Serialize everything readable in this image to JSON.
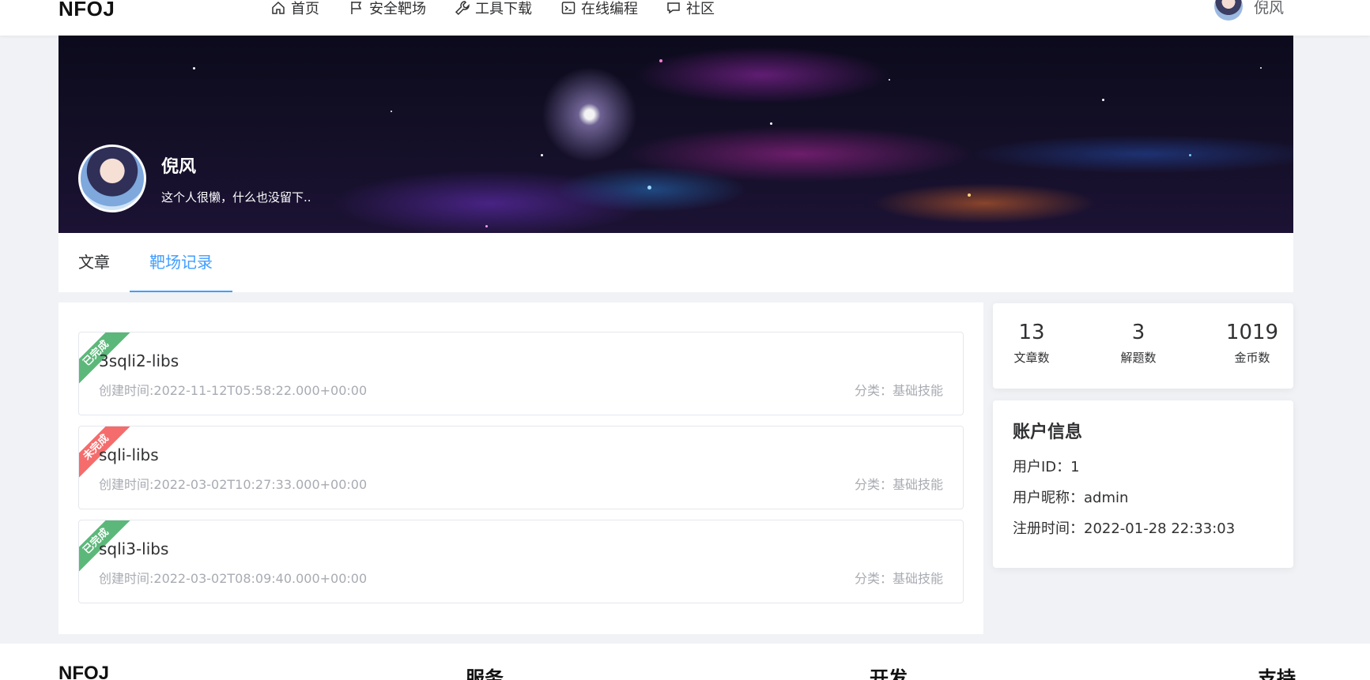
{
  "nav": {
    "brand": "NFOJ",
    "items": [
      {
        "label": "首页",
        "icon": "home-icon"
      },
      {
        "label": "安全靶场",
        "icon": "flag-icon"
      },
      {
        "label": "工具下载",
        "icon": "wrench-icon"
      },
      {
        "label": "在线编程",
        "icon": "terminal-icon"
      },
      {
        "label": "社区",
        "icon": "chat-icon"
      }
    ],
    "username": "倪风"
  },
  "profile": {
    "name": "倪风",
    "bio": "这个人很懒，什么也没留下.."
  },
  "tabs": [
    {
      "label": "文章",
      "active": false
    },
    {
      "label": "靶场记录",
      "active": true
    }
  ],
  "records": [
    {
      "status": "已完成",
      "status_color": "#5cb87a",
      "title": "3sqli2-libs",
      "created": "创建时间:2022-11-12T05:58:22.000+00:00",
      "category": "分类：基础技能"
    },
    {
      "status": "未完成",
      "status_color": "#f56c6c",
      "title": "sqli-libs",
      "created": "创建时间:2022-03-02T10:27:33.000+00:00",
      "category": "分类：基础技能"
    },
    {
      "status": "已完成",
      "status_color": "#5cb87a",
      "title": "sqli3-libs",
      "created": "创建时间:2022-03-02T08:09:40.000+00:00",
      "category": "分类：基础技能"
    }
  ],
  "stats": {
    "articles": {
      "value": "13",
      "label": "文章数"
    },
    "solved": {
      "value": "3",
      "label": "解题数"
    },
    "coins": {
      "value": "1019",
      "label": "金币数"
    }
  },
  "account": {
    "title": "账户信息",
    "user_id": "用户ID：1",
    "nickname": "用户昵称：admin",
    "registered": "注册时间：2022-01-28 22:33:03"
  },
  "footer": {
    "brand": "NFOJ",
    "service": "服务",
    "dev": "开发",
    "support": "支持"
  },
  "colors": {
    "accent": "#409eff",
    "done": "#5cb87a",
    "undone": "#f56c6c"
  }
}
